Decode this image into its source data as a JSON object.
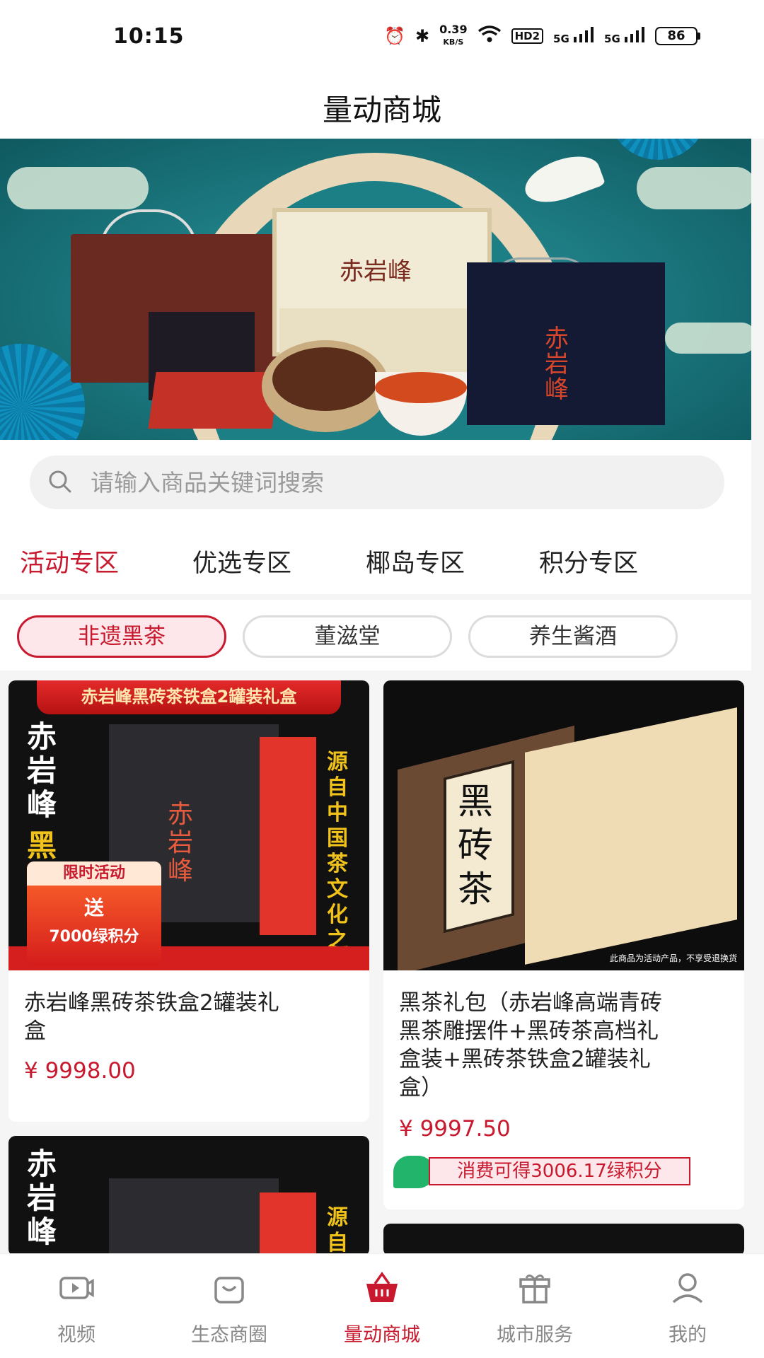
{
  "status_bar": {
    "time": "10:15",
    "net_speed_value": "0.39",
    "net_speed_unit": "KB/S",
    "hd_label": "HD2",
    "sig1_label": "5G",
    "sig2_label": "5G",
    "battery": "86",
    "icons": [
      "alarm-icon",
      "bluetooth-icon",
      "wifi-icon",
      "signal-icon",
      "battery-icon"
    ]
  },
  "header": {
    "title": "量动商城"
  },
  "banner": {
    "brand_text": "赤岩峰",
    "slide_count": 3,
    "active_slide": 3
  },
  "search": {
    "placeholder": "请输入商品关键词搜索"
  },
  "zone_tabs": [
    {
      "label": "活动专区",
      "active": true
    },
    {
      "label": "优选专区",
      "active": false
    },
    {
      "label": "椰岛专区",
      "active": false
    },
    {
      "label": "积分专区",
      "active": false
    }
  ],
  "chips": [
    {
      "label": "非遗黑茶",
      "active": true
    },
    {
      "label": "董滋堂",
      "active": false
    },
    {
      "label": "养生酱酒",
      "active": false
    }
  ],
  "products": [
    {
      "image_banner": "赤岩峰黑砖茶铁盒2罐装礼盒",
      "image_side_left": "赤岩峰",
      "image_side_left_y": "黑砖茶",
      "image_side_right": "源自中国茶文化之乡",
      "image_brand": "赤岩峰",
      "promo_title": "限时活动",
      "promo_gift": "送",
      "promo_points": "7000绿积分",
      "title_line1": "赤岩峰黑砖茶铁盒2罐装礼",
      "title_line2": "盒",
      "price": "¥ 9998.00"
    },
    {
      "image_label": "黑砖茶",
      "image_note": "此商品为活动产品，不享受退换货",
      "title_line1": "黑茶礼包（赤岩峰高端青砖",
      "title_line2": "黑茶雕摆件+黑砖茶高档礼",
      "title_line3": "盒装+黑砖茶铁盒2罐装礼",
      "title_line4": "盒）",
      "price": "¥ 9997.50",
      "points_text": "消费可得3006.17绿积分"
    },
    {
      "image_side_left": "赤岩峰",
      "image_side_right": "源自"
    }
  ],
  "bottom_nav": [
    {
      "label": "视频",
      "icon": "video-icon",
      "active": false
    },
    {
      "label": "生态商圈",
      "icon": "shopping-bag-icon",
      "active": false
    },
    {
      "label": "量动商城",
      "icon": "basket-icon",
      "active": true
    },
    {
      "label": "城市服务",
      "icon": "gift-box-icon",
      "active": false
    },
    {
      "label": "我的",
      "icon": "user-icon",
      "active": false
    }
  ],
  "colors": {
    "accent": "#c8192e",
    "points_green": "#22b46a"
  }
}
